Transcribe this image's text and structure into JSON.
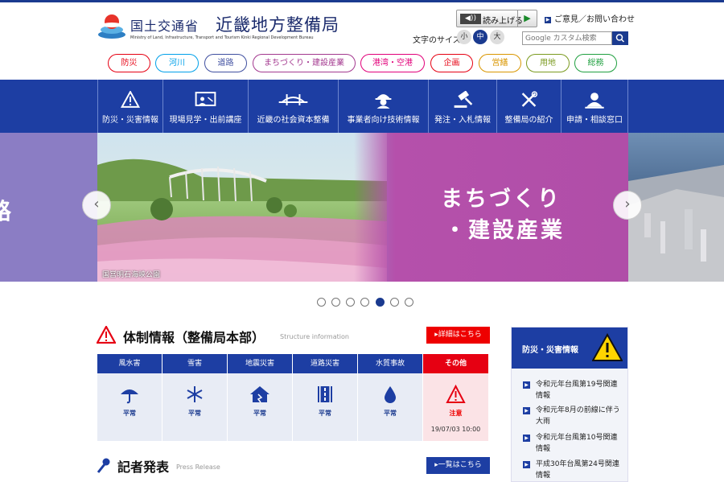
{
  "header": {
    "org_name": "国土交通省",
    "bureau_name": "近畿地方整備局",
    "org_en": "Ministry of Land, Infrastructure, Transport and Tourism Kinki Regional Development Bureau",
    "readaloud_label": "読み上げる",
    "contact_label": "ご意見／お問い合わせ",
    "fontsize_label": "文字のサイズ",
    "fontsize_options": [
      "小",
      "中",
      "大"
    ],
    "search_placeholder": "Google カスタム検索"
  },
  "categories": [
    {
      "label": "防災",
      "color": "#e60012"
    },
    {
      "label": "河川",
      "color": "#00a0e9"
    },
    {
      "label": "道路",
      "color": "#3f4fa0"
    },
    {
      "label": "まちづくり・建設産業",
      "color": "#a3388f"
    },
    {
      "label": "港湾・空港",
      "color": "#e2007a"
    },
    {
      "label": "企画",
      "color": "#e60012"
    },
    {
      "label": "営繕",
      "color": "#d99600"
    },
    {
      "label": "用地",
      "color": "#7a9a1f"
    },
    {
      "label": "総務",
      "color": "#20a040"
    }
  ],
  "nav": [
    {
      "label": "防災・災害情報",
      "icon": "warning-icon"
    },
    {
      "label": "現場見学・出前講座",
      "icon": "presentation-icon"
    },
    {
      "label": "近畿の社会資本整備",
      "icon": "bridge-icon"
    },
    {
      "label": "事業者向け技術情報",
      "icon": "worker-icon"
    },
    {
      "label": "発注・入札情報",
      "icon": "gavel-icon"
    },
    {
      "label": "整備局の紹介",
      "icon": "tools-icon"
    },
    {
      "label": "申請・相談窓口",
      "icon": "person-icon"
    }
  ],
  "hero": {
    "left_fragment": "路",
    "title_line1": "まちづくり",
    "title_line2": "・建設産業",
    "caption": "国営明石海峡公園",
    "slide_count": 7,
    "active_slide": 5
  },
  "status_section": {
    "title": "体制情報（整備局本部）",
    "title_en": "Structure information",
    "detail_button": "詳細はこちら",
    "columns": [
      {
        "label": "風水害",
        "value": "平常",
        "icon": "umbrella-icon",
        "alert": false
      },
      {
        "label": "雪害",
        "value": "平常",
        "icon": "snowflake-icon",
        "alert": false
      },
      {
        "label": "地震災害",
        "value": "平常",
        "icon": "house-quake-icon",
        "alert": false
      },
      {
        "label": "道路災害",
        "value": "平常",
        "icon": "road-icon",
        "alert": false
      },
      {
        "label": "水質事故",
        "value": "平常",
        "icon": "water-drop-icon",
        "alert": false
      },
      {
        "label": "その他",
        "value": "注意",
        "icon": "warning-icon",
        "alert": true,
        "timestamp": "19/07/03 10:00"
      }
    ]
  },
  "press": {
    "title": "記者発表",
    "title_en": "Press Release",
    "list_button": "一覧はこちら"
  },
  "disaster_info": {
    "title": "防災・災害情報",
    "items": [
      {
        "label": "令和元年台風第19号関連情報"
      },
      {
        "label": "令和元年8月の前線に伴う大雨"
      },
      {
        "label": "令和元年台風第10号関連情報"
      },
      {
        "label": "平成30年台風第24号関連情報"
      }
    ]
  },
  "colors": {
    "brand": "#1d3ea3",
    "alert": "#e60012"
  }
}
